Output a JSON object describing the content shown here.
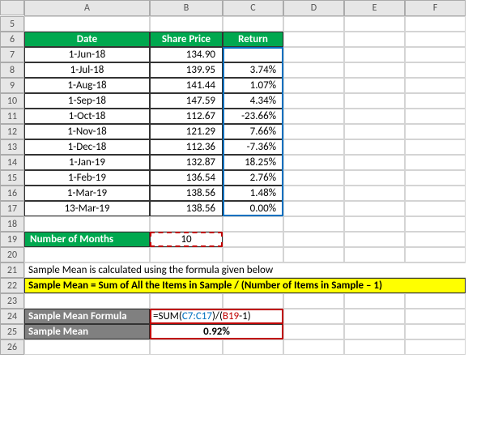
{
  "cols": [
    "A",
    "B",
    "C",
    "D",
    "E",
    "F"
  ],
  "rows": [
    "5",
    "6",
    "7",
    "8",
    "9",
    "10",
    "11",
    "12",
    "13",
    "14",
    "15",
    "16",
    "17",
    "18",
    "19",
    "20",
    "21",
    "22",
    "23",
    "24",
    "25",
    "26"
  ],
  "headers": {
    "date": "Date",
    "price": "Share Price",
    "return": "Return"
  },
  "table": [
    {
      "date": "1-Jun-18",
      "price": "134.90",
      "ret": ""
    },
    {
      "date": "1-Jul-18",
      "price": "139.95",
      "ret": "3.74%"
    },
    {
      "date": "1-Aug-18",
      "price": "141.44",
      "ret": "1.07%"
    },
    {
      "date": "1-Sep-18",
      "price": "147.59",
      "ret": "4.34%"
    },
    {
      "date": "1-Oct-18",
      "price": "112.67",
      "ret": "-23.66%"
    },
    {
      "date": "1-Nov-18",
      "price": "121.29",
      "ret": "7.66%"
    },
    {
      "date": "1-Dec-18",
      "price": "112.36",
      "ret": "-7.36%"
    },
    {
      "date": "1-Jan-19",
      "price": "132.87",
      "ret": "18.25%"
    },
    {
      "date": "1-Feb-19",
      "price": "136.54",
      "ret": "2.76%"
    },
    {
      "date": "1-Mar-19",
      "price": "138.56",
      "ret": "1.48%"
    },
    {
      "date": "13-Mar-19",
      "price": "138.56",
      "ret": "0.00%"
    }
  ],
  "months_label": "Number of Months",
  "months_value": "10",
  "desc_text": "Sample Mean is calculated using the formula given below",
  "formula_desc": "Sample Mean = Sum of All the Items in Sample / (Number of Items in Sample – 1)",
  "smf_label": "Sample Mean Formula",
  "sm_label": "Sample Mean",
  "formula": {
    "eq": "=",
    "fn": "SUM",
    "p1": "(",
    "ref1": "C7:C17",
    "p2": ")/(",
    "ref2": "B19",
    "tail": "-1)"
  },
  "result": "0.92%"
}
